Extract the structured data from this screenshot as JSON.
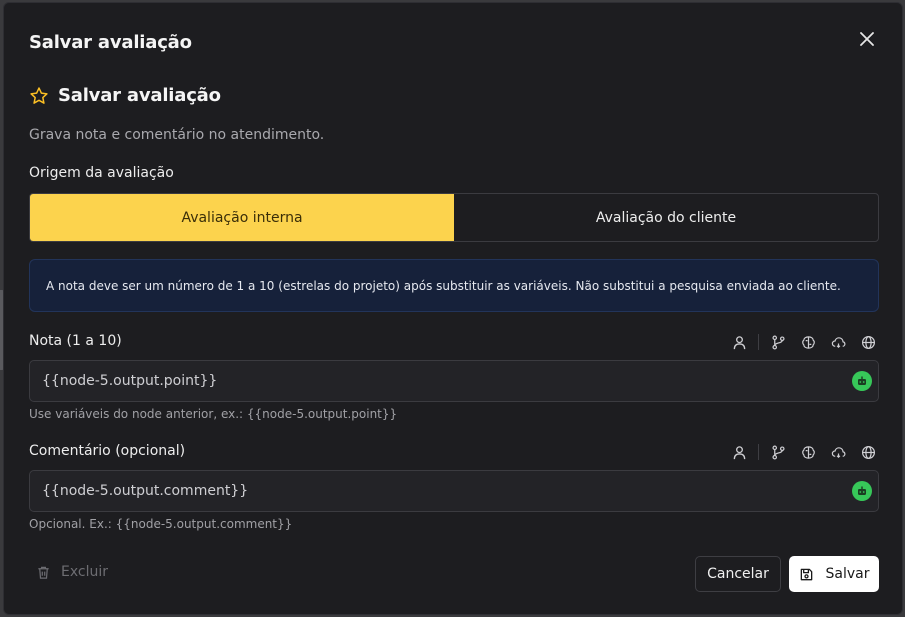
{
  "modal": {
    "title": "Salvar avaliação",
    "close_icon": "close-icon"
  },
  "section": {
    "icon": "star-icon",
    "title": "Salvar avaliação",
    "description": "Grava nota e comentário no atendimento."
  },
  "origin": {
    "label": "Origem da avaliação",
    "options": [
      "Avaliação interna",
      "Avaliação do cliente"
    ],
    "selected": "Avaliação interna",
    "active_color": "#fcd34d"
  },
  "info": {
    "text": "A nota deve ser um número de 1 a 10 (estrelas do projeto) após substituir as variáveis. Não substitui a pesquisa enviada ao cliente."
  },
  "fields": [
    {
      "label": "Nota (1 a 10)",
      "value": "{{node-5.output.point}}",
      "hint": "Use variáveis do node anterior, ex.: {{node-5.output.point}}"
    },
    {
      "label": "Comentário (opcional)",
      "value": "{{node-5.output.comment}}",
      "hint": "Opcional. Ex.: {{node-5.output.comment}}"
    }
  ],
  "toolbar_icons": [
    "user-icon",
    "git-branch-icon",
    "brain-icon",
    "cloud-icon",
    "globe-icon"
  ],
  "footer": {
    "delete_label": "Excluir",
    "cancel_label": "Cancelar",
    "save_label": "Salvar"
  },
  "colors": {
    "accent": "#fcd34d",
    "bot": "#37c759",
    "info_bg": "#16213a"
  }
}
